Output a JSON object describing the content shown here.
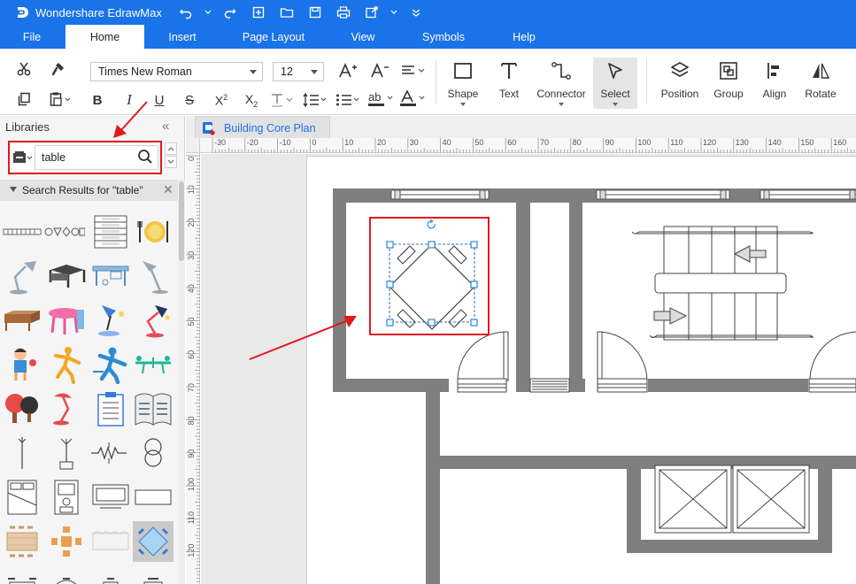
{
  "app": {
    "title": "Wondershare EdrawMax",
    "brand_color": "#1a73e8",
    "quick_access_icons": [
      "undo-icon",
      "redo-icon",
      "new-icon",
      "open-icon",
      "save-icon",
      "print-icon",
      "export-icon",
      "more-icon"
    ]
  },
  "menu": {
    "tabs": [
      "File",
      "Home",
      "Insert",
      "Page Layout",
      "View",
      "Symbols",
      "Help"
    ],
    "active": "Home"
  },
  "ribbon": {
    "font_family": "Times New Roman",
    "font_size": "12",
    "tools": [
      {
        "label": "Shape",
        "icon": "rectangle-icon"
      },
      {
        "label": "Text",
        "icon": "text-tool-icon"
      },
      {
        "label": "Connector",
        "icon": "connector-icon"
      },
      {
        "label": "Select",
        "icon": "cursor-icon",
        "selected": true
      },
      {
        "label": "Position",
        "icon": "layers-icon"
      },
      {
        "label": "Group",
        "icon": "group-icon"
      },
      {
        "label": "Align",
        "icon": "align-left-icon"
      },
      {
        "label": "Rotate",
        "icon": "rotate-icon"
      }
    ]
  },
  "libraries": {
    "title": "Libraries",
    "search_value": "table",
    "result_title": "Search Results for  \"table\""
  },
  "document": {
    "tab_title": "Building Core Plan"
  },
  "rulers": {
    "horizontal": [
      "-30",
      "-20",
      "-10",
      "0",
      "10",
      "20",
      "30",
      "40",
      "50",
      "60",
      "70",
      "80",
      "90",
      "100",
      "110",
      "120",
      "130",
      "140",
      "150",
      "160"
    ],
    "vertical": [
      "0",
      "10",
      "20",
      "30",
      "40",
      "50",
      "60",
      "70",
      "80",
      "90",
      "100",
      "110",
      "120"
    ]
  },
  "annotation_color": "#e0191f"
}
